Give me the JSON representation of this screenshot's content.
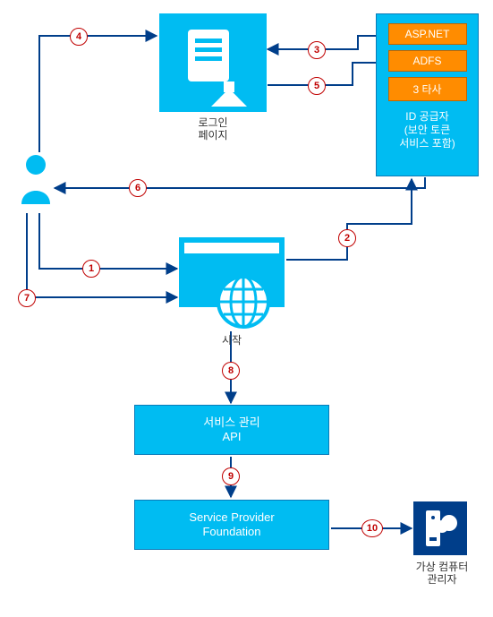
{
  "login_page": {
    "label_line1": "로그인",
    "label_line2": "페이지"
  },
  "id_provider": {
    "title_line1": "ID 공급자",
    "title_line2": "(보안 토큰",
    "title_line3": "서비스 포함)",
    "items": {
      "aspnet": "ASP.NET",
      "adfs": "ADFS",
      "third": "3 타사"
    }
  },
  "start": {
    "label": "시작"
  },
  "service_api": {
    "line1": "서비스 관리",
    "line2": "API"
  },
  "spf": {
    "line1": "Service Provider",
    "line2": "Foundation"
  },
  "vmm": {
    "line1": "가상 컴퓨터",
    "line2": "관리자"
  },
  "steps": {
    "s1": "1",
    "s2": "2",
    "s3": "3",
    "s4": "4",
    "s5": "5",
    "s6": "6",
    "s7": "7",
    "s8": "8",
    "s9": "9",
    "s10": "10"
  },
  "chart_data": {
    "type": "diagram",
    "nodes": [
      {
        "id": "user",
        "label": "(user)"
      },
      {
        "id": "login",
        "label": "로그인 페이지"
      },
      {
        "id": "idp",
        "label": "ID 공급자 (보안 토큰 서비스 포함)",
        "subitems": [
          "ASP.NET",
          "ADFS",
          "3 타사"
        ]
      },
      {
        "id": "start",
        "label": "시작"
      },
      {
        "id": "svc_api",
        "label": "서비스 관리 API"
      },
      {
        "id": "spf",
        "label": "Service Provider Foundation"
      },
      {
        "id": "vmm",
        "label": "가상 컴퓨터 관리자"
      }
    ],
    "edges": [
      {
        "step": 1,
        "from": "user",
        "to": "start"
      },
      {
        "step": 2,
        "from": "start",
        "to": "idp"
      },
      {
        "step": 3,
        "from": "idp",
        "to": "login"
      },
      {
        "step": 4,
        "from": "user",
        "to": "login"
      },
      {
        "step": 5,
        "from": "login",
        "to": "idp"
      },
      {
        "step": 6,
        "from": "idp",
        "to": "user"
      },
      {
        "step": 7,
        "from": "user",
        "to": "start"
      },
      {
        "step": 8,
        "from": "start",
        "to": "svc_api"
      },
      {
        "step": 9,
        "from": "svc_api",
        "to": "spf"
      },
      {
        "step": 10,
        "from": "spf",
        "to": "vmm"
      }
    ]
  }
}
